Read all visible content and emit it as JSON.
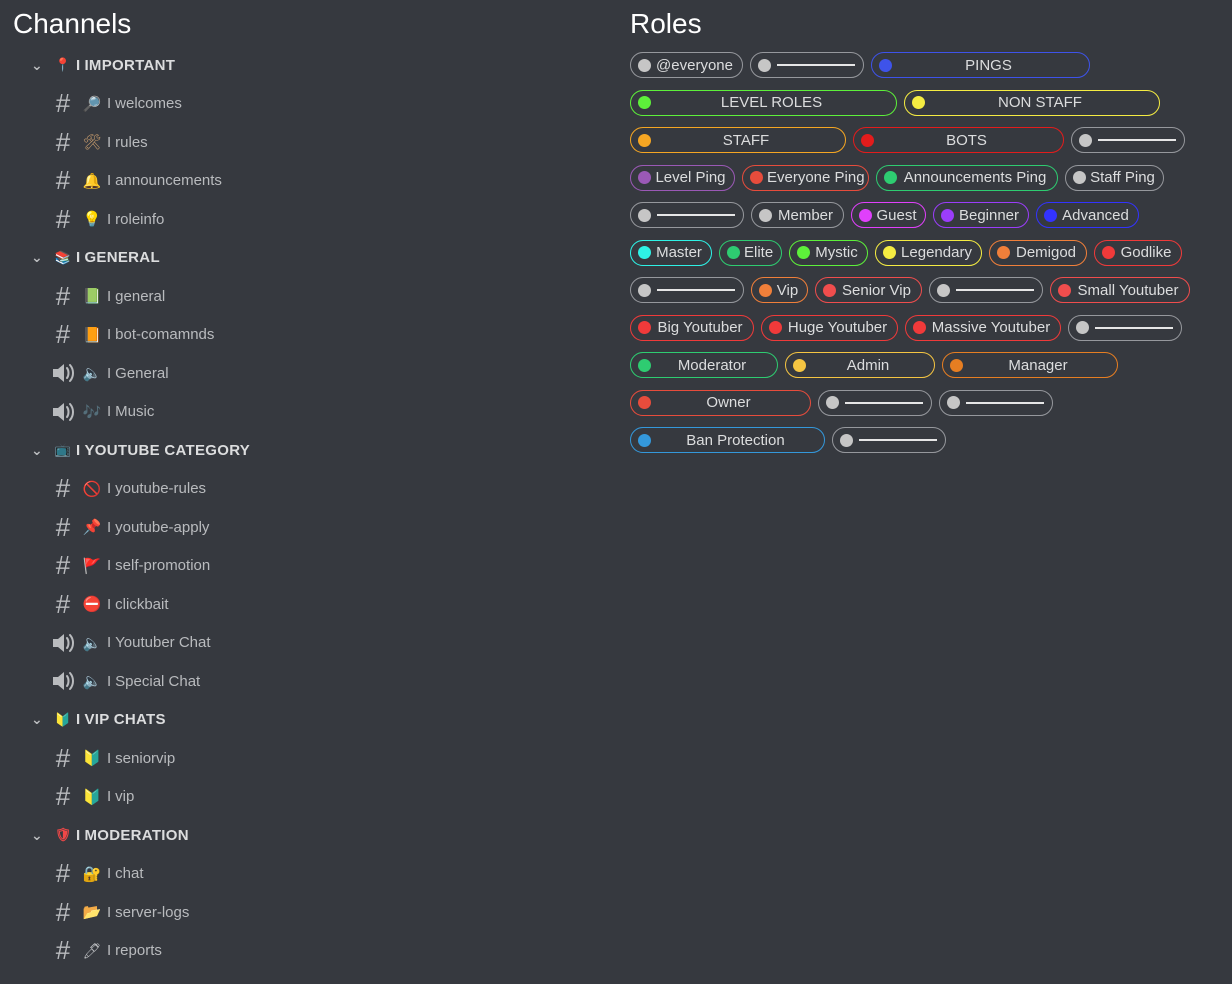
{
  "channels_title": "Channels",
  "roles_title": "Roles",
  "channels": [
    {
      "type": "category",
      "name": "IMPORTANT",
      "emoji": "pin",
      "color": "#f04747"
    },
    {
      "type": "text",
      "name": "welcomes",
      "emoji": "magnifier",
      "color": "#7fb8e6"
    },
    {
      "type": "text",
      "name": "rules",
      "emoji": "tools",
      "color": "#c49a6c"
    },
    {
      "type": "text",
      "name": "announcements",
      "emoji": "bell",
      "color": "#f5c542"
    },
    {
      "type": "text",
      "name": "roleinfo",
      "emoji": "bulb",
      "color": "#f5d442"
    },
    {
      "type": "category",
      "name": "GENERAL",
      "emoji": "books",
      "color": "#e8b15a"
    },
    {
      "type": "text",
      "name": "general",
      "emoji": "green-book",
      "color": "#3ba55c"
    },
    {
      "type": "text",
      "name": "bot-comamnds",
      "emoji": "orange-book",
      "color": "#e67e22"
    },
    {
      "type": "voice",
      "name": "General",
      "emoji": "speaker",
      "color": "#b9bbbe"
    },
    {
      "type": "voice",
      "name": "Music",
      "emoji": "notes",
      "color": "#9b84ec"
    },
    {
      "type": "category",
      "name": "YOUTUBE CATEGORY",
      "emoji": "tv",
      "color": "#f04747"
    },
    {
      "type": "text",
      "name": "youtube-rules",
      "emoji": "no-sign",
      "color": "#f04747"
    },
    {
      "type": "text",
      "name": "youtube-apply",
      "emoji": "pushpin",
      "color": "#e74c3c"
    },
    {
      "type": "text",
      "name": "self-promotion",
      "emoji": "red-flag",
      "color": "#e74c3c"
    },
    {
      "type": "text",
      "name": "clickbait",
      "emoji": "no-entry",
      "color": "#e74c3c"
    },
    {
      "type": "voice",
      "name": "Youtuber Chat",
      "emoji": "speaker",
      "color": "#b9bbbe"
    },
    {
      "type": "voice",
      "name": "Special Chat",
      "emoji": "speaker",
      "color": "#b9bbbe"
    },
    {
      "type": "category",
      "name": "VIP CHATS",
      "emoji": "beginner",
      "color": "#3ba55c"
    },
    {
      "type": "text",
      "name": "seniorvip",
      "emoji": "beginner",
      "color": "#3ba55c"
    },
    {
      "type": "text",
      "name": "vip",
      "emoji": "beginner",
      "color": "#3ba55c"
    },
    {
      "type": "category",
      "name": "MODERATION",
      "emoji": "shield",
      "color": "#f04747"
    },
    {
      "type": "text",
      "name": "chat",
      "emoji": "lock",
      "color": "#f5c542"
    },
    {
      "type": "text",
      "name": "server-logs",
      "emoji": "folder",
      "color": "#f5b342"
    },
    {
      "type": "text",
      "name": "reports",
      "emoji": "pen",
      "color": "#b9bbbe"
    }
  ],
  "separator": "I",
  "roles": [
    [
      {
        "label": "@everyone",
        "color": "#c6c6c6",
        "border": "#96989d",
        "w": 113
      },
      {
        "label": "",
        "color": "#c6c6c6",
        "border": "#96989d",
        "w": 114
      },
      {
        "label": "PINGS",
        "color": "#3e53ea",
        "border": "#3e53ea",
        "w": 219
      }
    ],
    [
      {
        "label": "LEVEL ROLES",
        "color": "#5df03a",
        "border": "#5df03a",
        "w": 267
      },
      {
        "label": "NON STAFF",
        "color": "#f5ec42",
        "border": "#f5ec42",
        "w": 256
      }
    ],
    [
      {
        "label": "STAFF",
        "color": "#f5a623",
        "border": "#f5a623",
        "w": 216
      },
      {
        "label": "BOTS",
        "color": "#e31c1c",
        "border": "#e31c1c",
        "w": 211
      },
      {
        "label": "",
        "color": "#c6c6c6",
        "border": "#96989d",
        "w": 114
      }
    ],
    [
      {
        "label": "Level Ping",
        "color": "#9b59b6",
        "border": "#9b59b6",
        "w": 105
      },
      {
        "label": "Everyone Ping",
        "color": "#e74c3c",
        "border": "#e74c3c",
        "w": 127
      },
      {
        "label": "Announcements Ping",
        "color": "#2ecc71",
        "border": "#2ecc71",
        "w": 182
      },
      {
        "label": "Staff Ping",
        "color": "#c6c6c6",
        "border": "#96989d",
        "w": 99
      }
    ],
    [
      {
        "label": "",
        "color": "#c6c6c6",
        "border": "#96989d",
        "w": 114
      },
      {
        "label": "Member",
        "color": "#c6c6c6",
        "border": "#96989d",
        "w": 93
      },
      {
        "label": "Guest",
        "color": "#e040fb",
        "border": "#e040fb",
        "w": 75
      },
      {
        "label": "Beginner",
        "color": "#9b3dfa",
        "border": "#9b3dfa",
        "w": 96
      },
      {
        "label": "Advanced",
        "color": "#3333ff",
        "border": "#3333ff",
        "w": 103
      }
    ],
    [
      {
        "label": "Master",
        "color": "#2ef2e6",
        "border": "#2ef2e6",
        "w": 82
      },
      {
        "label": "Elite",
        "color": "#2ecc71",
        "border": "#2ecc71",
        "w": 63
      },
      {
        "label": "Mystic",
        "color": "#5df03a",
        "border": "#5df03a",
        "w": 79
      },
      {
        "label": "Legendary",
        "color": "#f5ec42",
        "border": "#f5ec42",
        "w": 107
      },
      {
        "label": "Demigod",
        "color": "#f07f3a",
        "border": "#f07f3a",
        "w": 98
      },
      {
        "label": "Godlike",
        "color": "#f03a3a",
        "border": "#f03a3a",
        "w": 88
      }
    ],
    [
      {
        "label": "",
        "color": "#c6c6c6",
        "border": "#96989d",
        "w": 114
      },
      {
        "label": "Vip",
        "color": "#f07f3a",
        "border": "#f07f3a",
        "w": 57
      },
      {
        "label": "Senior Vip",
        "color": "#f04d4d",
        "border": "#f04d4d",
        "w": 107
      },
      {
        "label": "",
        "color": "#c6c6c6",
        "border": "#96989d",
        "w": 114
      },
      {
        "label": "Small Youtuber",
        "color": "#f04d4d",
        "border": "#f04d4d",
        "w": 140
      }
    ],
    [
      {
        "label": "Big Youtuber",
        "color": "#f03a3a",
        "border": "#f03a3a",
        "w": 124
      },
      {
        "label": "Huge Youtuber",
        "color": "#f03a3a",
        "border": "#f03a3a",
        "w": 137
      },
      {
        "label": "Massive Youtuber",
        "color": "#f03a3a",
        "border": "#f03a3a",
        "w": 156
      },
      {
        "label": "",
        "color": "#c6c6c6",
        "border": "#96989d",
        "w": 114
      }
    ],
    [
      {
        "label": "Moderator",
        "color": "#2ecc71",
        "border": "#2ecc71",
        "w": 148
      },
      {
        "label": "Admin",
        "color": "#f5c542",
        "border": "#f5c542",
        "w": 150
      },
      {
        "label": "Manager",
        "color": "#e67e22",
        "border": "#e67e22",
        "w": 176
      }
    ],
    [
      {
        "label": "Owner",
        "color": "#e74c3c",
        "border": "#e74c3c",
        "w": 181
      },
      {
        "label": "",
        "color": "#c6c6c6",
        "border": "#96989d",
        "w": 114
      },
      {
        "label": "",
        "color": "#c6c6c6",
        "border": "#96989d",
        "w": 114
      }
    ],
    [
      {
        "label": "Ban Protection",
        "color": "#3498db",
        "border": "#3498db",
        "w": 195
      },
      {
        "label": "",
        "color": "#c6c6c6",
        "border": "#96989d",
        "w": 114
      }
    ]
  ]
}
